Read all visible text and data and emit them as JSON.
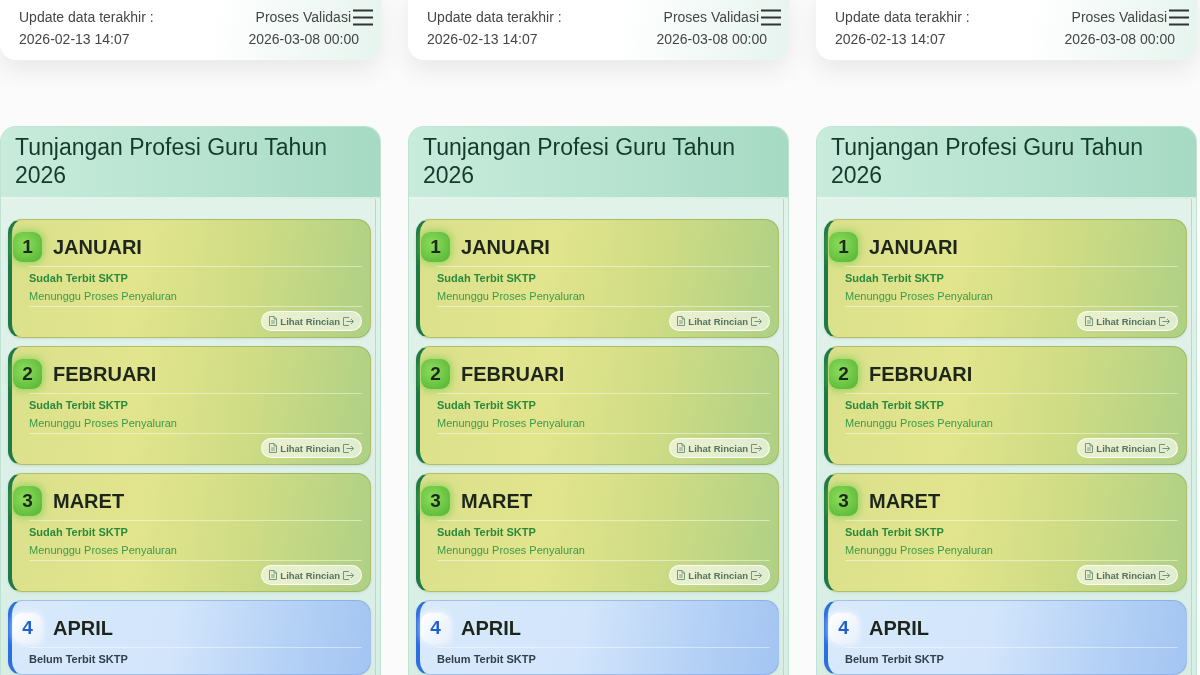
{
  "panels": [
    {
      "info_bar": {
        "update_label": "Update data terakhir :",
        "update_value": "2026-02-13 14:07",
        "validation_label": "Proses Validasi",
        "validation_value": "2026-03-08 00:00"
      },
      "title": "Tunjangan Profesi Guru Tahun 2026",
      "months": [
        {
          "number": "1",
          "name": "JANUARI",
          "kind": "issued",
          "sktp_status": "Sudah Terbit SKTP",
          "distribution_status": "Menunggu Proses Penyaluran",
          "button": "Lihat Rincian"
        },
        {
          "number": "2",
          "name": "FEBRUARI",
          "kind": "issued",
          "sktp_status": "Sudah Terbit SKTP",
          "distribution_status": "Menunggu Proses Penyaluran",
          "button": "Lihat Rincian"
        },
        {
          "number": "3",
          "name": "MARET",
          "kind": "issued",
          "sktp_status": "Sudah Terbit SKTP",
          "distribution_status": "Menunggu Proses Penyaluran",
          "button": "Lihat Rincian"
        },
        {
          "number": "4",
          "name": "APRIL",
          "kind": "pending",
          "sktp_status": "Belum Terbit SKTP"
        }
      ]
    },
    {
      "info_bar": {
        "update_label": "Update data terakhir :",
        "update_value": "2026-02-13 14:07",
        "validation_label": "Proses Validasi",
        "validation_value": "2026-03-08 00:00"
      },
      "title": "Tunjangan Profesi Guru Tahun 2026",
      "months": [
        {
          "number": "1",
          "name": "JANUARI",
          "kind": "issued",
          "sktp_status": "Sudah Terbit SKTP",
          "distribution_status": "Menunggu Proses Penyaluran",
          "button": "Lihat Rincian"
        },
        {
          "number": "2",
          "name": "FEBRUARI",
          "kind": "issued",
          "sktp_status": "Sudah Terbit SKTP",
          "distribution_status": "Menunggu Proses Penyaluran",
          "button": "Lihat Rincian"
        },
        {
          "number": "3",
          "name": "MARET",
          "kind": "issued",
          "sktp_status": "Sudah Terbit SKTP",
          "distribution_status": "Menunggu Proses Penyaluran",
          "button": "Lihat Rincian"
        },
        {
          "number": "4",
          "name": "APRIL",
          "kind": "pending",
          "sktp_status": "Belum Terbit SKTP"
        }
      ]
    },
    {
      "info_bar": {
        "update_label": "Update data terakhir :",
        "update_value": "2026-02-13 14:07",
        "validation_label": "Proses Validasi",
        "validation_value": "2026-03-08 00:00"
      },
      "title": "Tunjangan Profesi Guru Tahun 2026",
      "months": [
        {
          "number": "1",
          "name": "JANUARI",
          "kind": "issued",
          "sktp_status": "Sudah Terbit SKTP",
          "distribution_status": "Menunggu Proses Penyaluran",
          "button": "Lihat Rincian"
        },
        {
          "number": "2",
          "name": "FEBRUARI",
          "kind": "issued",
          "sktp_status": "Sudah Terbit SKTP",
          "distribution_status": "Menunggu Proses Penyaluran",
          "button": "Lihat Rincian"
        },
        {
          "number": "3",
          "name": "MARET",
          "kind": "issued",
          "sktp_status": "Sudah Terbit SKTP",
          "distribution_status": "Menunggu Proses Penyaluran",
          "button": "Lihat Rincian"
        },
        {
          "number": "4",
          "name": "APRIL",
          "kind": "pending",
          "sktp_status": "Belum Terbit SKTP"
        }
      ]
    }
  ]
}
